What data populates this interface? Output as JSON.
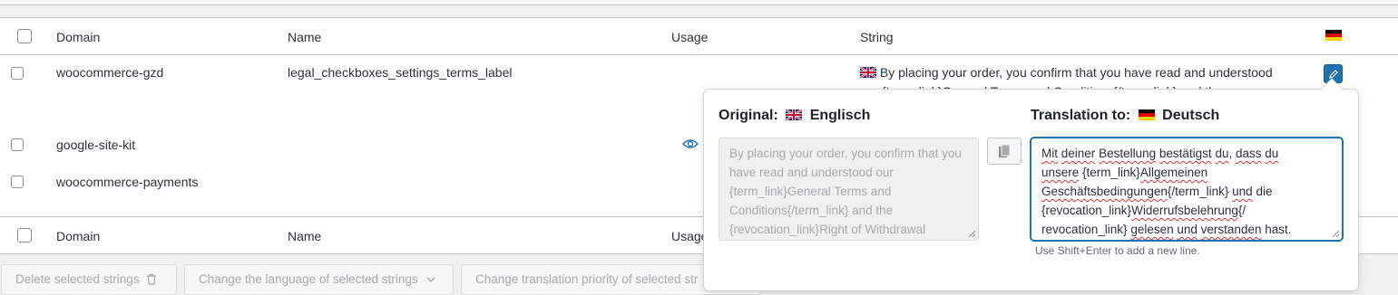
{
  "table": {
    "headers": {
      "domain": "Domain",
      "name": "Name",
      "usage": "Usage",
      "string": "String"
    },
    "rows": [
      {
        "domain": "woocommerce-gzd",
        "name": "legal_checkboxes_settings_terms_label",
        "string": "By placing your order, you confirm that you have read and understood",
        "string_line2": "our {term_link}General Terms and Conditions{/term_link} and the"
      },
      {
        "domain": "google-site-kit",
        "name": "",
        "usage_icon": "eye-icon"
      },
      {
        "domain": "woocommerce-payments",
        "name": ""
      }
    ],
    "footer_headers": {
      "domain": "Domain",
      "name": "Name",
      "usage": "Usage"
    }
  },
  "popup": {
    "original_label": "Original:",
    "original_lang": "Englisch",
    "translation_label": "Translation to:",
    "translation_lang": "Deutsch",
    "original_text": "By placing your order, you confirm that you have read and understood our {term_link}General Terms and Conditions{/term_link} and the {revocation_link}Right of Withdrawal",
    "translation_lines": [
      "Mit deiner Bestellung bestätigst du, dass du",
      "unsere {term_link}Allgemeinen",
      "Geschäftsbedingungen{/term_link} und die",
      "{revocation_link}Widerrufsbelehrung{/",
      "revocation_link} gelesen und verstanden hast."
    ],
    "hint": "Use Shift+Enter to add a new line."
  },
  "bulk_actions": {
    "delete": "Delete selected strings",
    "change_language": "Change the language of selected strings",
    "change_priority": "Change translation priority of selected str"
  },
  "colors": {
    "accent": "#2271b1",
    "squiggle": "#d63638"
  }
}
